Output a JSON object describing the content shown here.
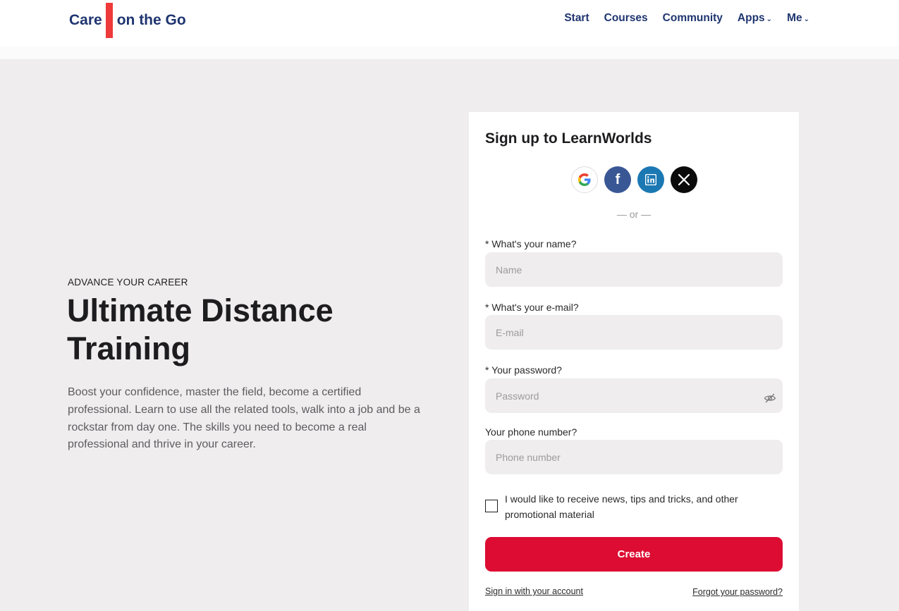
{
  "brand": {
    "left": "Care",
    "right": "on the Go",
    "accent_color": "#ee3a3a",
    "text_color": "#1f3570"
  },
  "nav": {
    "start": "Start",
    "courses": "Courses",
    "community": "Community",
    "apps": "Apps",
    "me": "Me"
  },
  "hero": {
    "eyebrow": "ADVANCE YOUR CAREER",
    "title": "Ultimate Distance Training",
    "text": "Boost your confidence, master the field, become a certified professional. Learn to use all the related tools, walk into a job and be a rockstar from day one. The skills you need to become a real professional and thrive in your career."
  },
  "signup": {
    "title": "Sign up to LearnWorlds",
    "social": [
      "google-icon",
      "facebook-icon",
      "linkedin-icon",
      "x-icon"
    ],
    "or_text": "— or —",
    "name_label": "* What's your name?",
    "name_placeholder": "Name",
    "email_label": "* What's your e-mail?",
    "email_placeholder": "E-mail",
    "password_label": "* Your password?",
    "password_placeholder": "Password",
    "phone_label": "Your phone number?",
    "phone_placeholder": "Phone number",
    "newsletter_label": "I would like to receive news, tips and tricks, and other promotional material",
    "create_label": "Create",
    "signin_link": "Sign in with your account",
    "forgot_link": "Forgot your password?",
    "button_color": "#dc0c32"
  }
}
